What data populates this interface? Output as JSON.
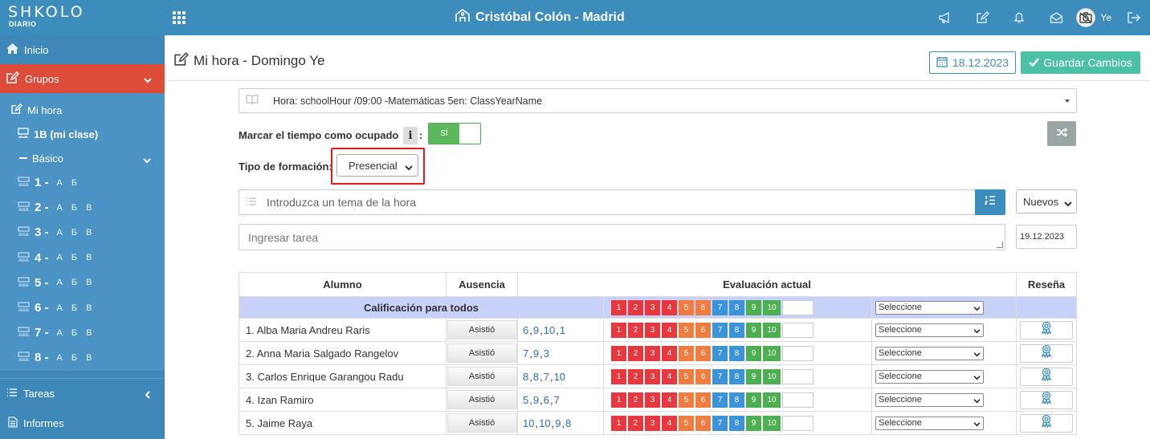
{
  "topbar": {
    "logo": "SHKOLO",
    "logo_sub": "DIARIO",
    "school_name": "Cristóbal Colón - Madrid",
    "user_name": "Ye"
  },
  "sidebar": {
    "inicio": "Inicio",
    "grupos": "Grupos",
    "mi_hora": "Mi hora",
    "mi_clase": "1B (mi clase)",
    "basico": "Básico",
    "grades": [
      {
        "num": "1 -",
        "sections": "А Б"
      },
      {
        "num": "2 -",
        "sections": "А Б В"
      },
      {
        "num": "3 -",
        "sections": "А Б В"
      },
      {
        "num": "4 -",
        "sections": "А Б В"
      },
      {
        "num": "5 -",
        "sections": "А Б В"
      },
      {
        "num": "6 -",
        "sections": "А Б В"
      },
      {
        "num": "7 -",
        "sections": "А Б В"
      },
      {
        "num": "8 -",
        "sections": "А Б В"
      }
    ],
    "tareas": "Tareas",
    "informes": "Informes"
  },
  "page": {
    "title": "Mi hora - Domingo Ye",
    "date_button": "18.12.2023",
    "save_button": "Guardar Cambios",
    "hora_select": "Hora: schoolHour /09:00 -Matemáticas 5en: ClassYearName",
    "busy_label": "Marcar el tiempo como ocupado",
    "info_badge": "i",
    "colon": ":",
    "toggle_on": "SÍ",
    "formacion_label": "Tipo de formación:",
    "formacion_value": "Presencial",
    "tema_placeholder": "Introduzca un tema de la hora",
    "nuevos_value": "Nuevos",
    "tarea_placeholder": "Ingresar tarea",
    "tarea_date": "19.12.2023"
  },
  "table": {
    "headers": {
      "alumno": "Alumno",
      "ausencia": "Ausencia",
      "evaluacion": "Evaluación actual",
      "resena": "Reseña"
    },
    "all_row_label": "Calificación para todos",
    "select_placeholder": "Seleccione",
    "grade_scale": [
      "1",
      "2",
      "3",
      "4",
      "5",
      "6",
      "7",
      "8",
      "9",
      "10"
    ],
    "grade_colors": {
      "red": "#e8383d",
      "orange": "#f07d3f",
      "blue": "#3b94d9",
      "green": "#4cb050"
    },
    "students": [
      {
        "name": "1. Alba Maria Andreu Raris",
        "status": "Asistió",
        "marks": [
          "6",
          "9",
          "10",
          "1"
        ]
      },
      {
        "name": "2. Anna Maria Salgado Rangelov",
        "status": "Asistió",
        "marks": [
          "7",
          "9",
          "3"
        ]
      },
      {
        "name": "3. Carlos Enrique Garangou Radu",
        "status": "Asistió",
        "marks": [
          "8",
          "8",
          "7",
          "10"
        ]
      },
      {
        "name": "4. Izan Ramiro",
        "status": "Asistió",
        "marks": [
          "5",
          "9",
          "6",
          "7"
        ]
      },
      {
        "name": "5. Jaime Raya",
        "status": "Asistió",
        "marks": [
          "10",
          "10",
          "9",
          "8"
        ]
      }
    ]
  }
}
